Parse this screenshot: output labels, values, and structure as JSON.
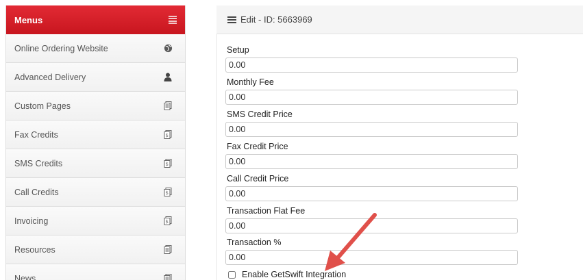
{
  "sidebar": {
    "header": {
      "label": "Menus",
      "icon": "menu-list-icon"
    },
    "items": [
      {
        "label": "Online Ordering Website",
        "icon": "globe-icon"
      },
      {
        "label": "Advanced Delivery",
        "icon": "user-icon"
      },
      {
        "label": "Custom Pages",
        "icon": "pages-icon"
      },
      {
        "label": "Fax Credits",
        "icon": "document-icon"
      },
      {
        "label": "SMS Credits",
        "icon": "document-icon"
      },
      {
        "label": "Call Credits",
        "icon": "document-icon"
      },
      {
        "label": "Invoicing",
        "icon": "document-icon"
      },
      {
        "label": "Resources",
        "icon": "pages-icon"
      },
      {
        "label": "News",
        "icon": "pages-icon"
      }
    ]
  },
  "main": {
    "title": "Edit - ID: 5663969",
    "fields": {
      "setup": {
        "label": "Setup",
        "value": "0.00"
      },
      "monthly_fee": {
        "label": "Monthly Fee",
        "value": "0.00"
      },
      "sms_credit_price": {
        "label": "SMS Credit Price",
        "value": "0.00"
      },
      "fax_credit_price": {
        "label": "Fax Credit Price",
        "value": "0.00"
      },
      "call_credit_price": {
        "label": "Call Credit Price",
        "value": "0.00"
      },
      "transaction_flat_fee": {
        "label": "Transaction Flat Fee",
        "value": "0.00"
      },
      "transaction_percent": {
        "label": "Transaction %",
        "value": "0.00"
      }
    },
    "getswift": {
      "label": "Enable GetSwift Integration",
      "checked": false
    }
  },
  "colors": {
    "accent": "#d31f2b",
    "annotation_arrow": "#e0504a"
  }
}
